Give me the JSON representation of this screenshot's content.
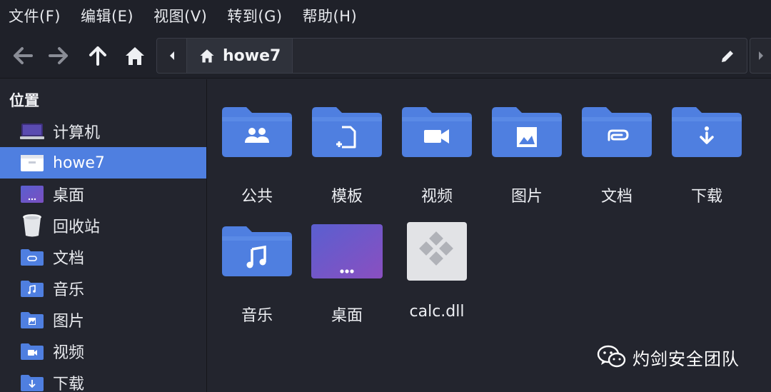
{
  "menubar": {
    "items": [
      "文件(F)",
      "编辑(E)",
      "视图(V)",
      "转到(G)",
      "帮助(H)"
    ]
  },
  "toolbar": {
    "back_icon": "arrow-left-icon",
    "forward_icon": "arrow-right-icon",
    "up_icon": "arrow-up-icon",
    "home_icon": "home-icon",
    "path": {
      "crumb_label": "howe7",
      "crumb_icon": "home-icon",
      "edit_icon": "pencil-icon"
    }
  },
  "sidebar": {
    "heading": "位置",
    "items": [
      {
        "label": "计算机",
        "icon": "computer-icon"
      },
      {
        "label": "howe7",
        "icon": "home-folder-icon",
        "selected": true
      },
      {
        "label": "桌面",
        "icon": "desktop-icon"
      },
      {
        "label": "回收站",
        "icon": "trash-icon"
      },
      {
        "label": "文档",
        "icon": "documents-folder-icon"
      },
      {
        "label": "音乐",
        "icon": "music-folder-icon"
      },
      {
        "label": "图片",
        "icon": "pictures-folder-icon"
      },
      {
        "label": "视频",
        "icon": "videos-folder-icon"
      },
      {
        "label": "下载",
        "icon": "downloads-folder-icon"
      }
    ]
  },
  "main": {
    "items": [
      {
        "label": "公共",
        "icon": "public-folder-icon"
      },
      {
        "label": "模板",
        "icon": "templates-folder-icon"
      },
      {
        "label": "视频",
        "icon": "videos-folder-icon"
      },
      {
        "label": "图片",
        "icon": "pictures-folder-icon"
      },
      {
        "label": "文档",
        "icon": "documents-folder-icon"
      },
      {
        "label": "下载",
        "icon": "downloads-folder-icon"
      },
      {
        "label": "音乐",
        "icon": "music-folder-icon"
      },
      {
        "label": "桌面",
        "icon": "desktop-folder-icon"
      },
      {
        "label": "calc.dll",
        "icon": "dll-file-icon"
      }
    ]
  },
  "watermark": {
    "text": "灼剑安全团队",
    "icon": "wechat-icon"
  },
  "colors": {
    "background": "#23252e",
    "accent": "#4f7fe0",
    "folder": "#4f7fe0"
  }
}
